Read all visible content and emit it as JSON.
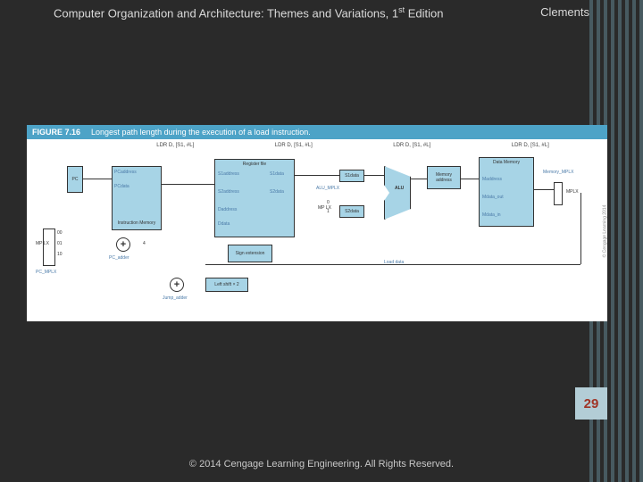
{
  "header": {
    "title_pre": "Computer Organization and Architecture: Themes and Variations, 1",
    "title_sup": "st",
    "title_post": " Edition",
    "author": "Clements"
  },
  "figure": {
    "number": "FIGURE 7.16",
    "caption": "Longest path length during the execution of a load instruction.",
    "top_instruction": "LDR  D, [S1, #L]",
    "side_copyright": "© Cengage Learning 2014"
  },
  "blocks": {
    "pc": "PC",
    "pc_address": "PCaddress",
    "pc_data": "PCdata",
    "instruction_memory": "Instruction Memory",
    "register_file": "Register file",
    "s1_address": "S1address",
    "s1_data": "S1data",
    "s2_address": "S2address",
    "s2_data": "S2data",
    "d_address": "Daddress",
    "d_data": "Ddata",
    "sign_extension": "Sign extension",
    "left_shift": "Left shift × 2",
    "s1": "S1data",
    "s2": "S2data",
    "alu": "ALU",
    "alu_mplx": "ALU_MPLX",
    "memory_address": "Memory address",
    "m_address": "Maddress",
    "m_data_out": "Mdata_out",
    "m_data_in": "Mdata_in",
    "data_memory": "Data Memory",
    "memory_mplx": "Memory_MPLX",
    "mplx_label": "MPLX",
    "pc_adder": "PC_adder",
    "jump_adder": "Jump_adder",
    "pc_mplx": "PC_MPLX",
    "load_data": "Load data",
    "four": "4",
    "mux_00": "00",
    "mux_01": "01",
    "mux_10": "10",
    "zero": "0",
    "one": "1",
    "mp_lx": "MP LX"
  },
  "page_number": "29",
  "footer": "© 2014 Cengage Learning Engineering. All Rights Reserved."
}
